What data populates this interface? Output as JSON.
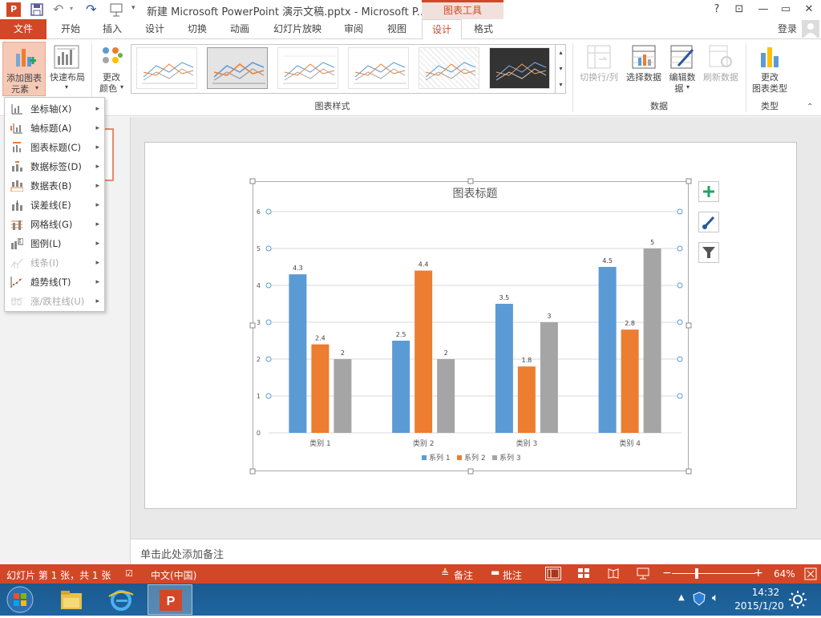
{
  "titlebar": {
    "title": "新建 Microsoft PowerPoint 演示文稿.pptx - Microsoft P...",
    "contextual_group": "图表工具",
    "help": "?",
    "restore_ribbon": "⊡",
    "minimize": "—",
    "maximize": "▭",
    "close": "✕"
  },
  "tabs": {
    "file": "文件",
    "home": "开始",
    "insert": "插入",
    "design": "设计",
    "transitions": "切换",
    "animations": "动画",
    "slideshow": "幻灯片放映",
    "review": "审阅",
    "view": "视图",
    "chart_design": "设计",
    "chart_format": "格式",
    "login": "登录"
  },
  "ribbon": {
    "add_element_l1": "添加图表",
    "add_element_l2": "元素",
    "quick_layout": "快速布局",
    "change_colors_l1": "更改",
    "change_colors_l2": "颜色",
    "chart_styles_group": "图表样式",
    "switch_row_col": "切换行/列",
    "select_data": "选择数据",
    "edit_data_l1": "编辑数",
    "edit_data_l2": "据",
    "refresh_data": "刷新数据",
    "data_group": "数据",
    "change_type_l1": "更改",
    "change_type_l2": "图表类型",
    "type_group": "类型"
  },
  "menu": {
    "items": [
      {
        "label": "坐标轴(X)",
        "enabled": true
      },
      {
        "label": "轴标题(A)",
        "enabled": true
      },
      {
        "label": "图表标题(C)",
        "enabled": true
      },
      {
        "label": "数据标签(D)",
        "enabled": true
      },
      {
        "label": "数据表(B)",
        "enabled": true
      },
      {
        "label": "误差线(E)",
        "enabled": true
      },
      {
        "label": "网格线(G)",
        "enabled": true
      },
      {
        "label": "图例(L)",
        "enabled": true
      },
      {
        "label": "线条(I)",
        "enabled": false
      },
      {
        "label": "趋势线(T)",
        "enabled": true
      },
      {
        "label": "涨/跌柱线(U)",
        "enabled": false
      }
    ]
  },
  "chart_data": {
    "type": "bar",
    "title": "图表标题",
    "categories": [
      "类别 1",
      "类别 2",
      "类别 3",
      "类别 4"
    ],
    "series": [
      {
        "name": "系列 1",
        "color": "#5b9bd5",
        "values": [
          4.3,
          2.5,
          3.5,
          4.5
        ]
      },
      {
        "name": "系列 2",
        "color": "#ed7d31",
        "values": [
          2.4,
          4.4,
          1.8,
          2.8
        ]
      },
      {
        "name": "系列 3",
        "color": "#a5a5a5",
        "values": [
          2,
          2,
          3,
          5
        ]
      }
    ],
    "ylim": [
      0,
      6
    ],
    "yticks": [
      0,
      1,
      2,
      3,
      4,
      5,
      6
    ],
    "grid": true,
    "legend": "bottom",
    "data_labels": true
  },
  "notes_placeholder": "单击此处添加备注",
  "status": {
    "slide_info": "幻灯片 第 1 张，共 1 张",
    "language": "中文(中国)",
    "notes": "备注",
    "comments": "批注",
    "zoom": "64%"
  },
  "taskbar": {
    "time": "14:32",
    "date": "2015/1/20"
  },
  "colors": {
    "accent": "#d24726",
    "series1": "#5b9bd5",
    "series2": "#ed7d31",
    "series3": "#a5a5a5"
  }
}
